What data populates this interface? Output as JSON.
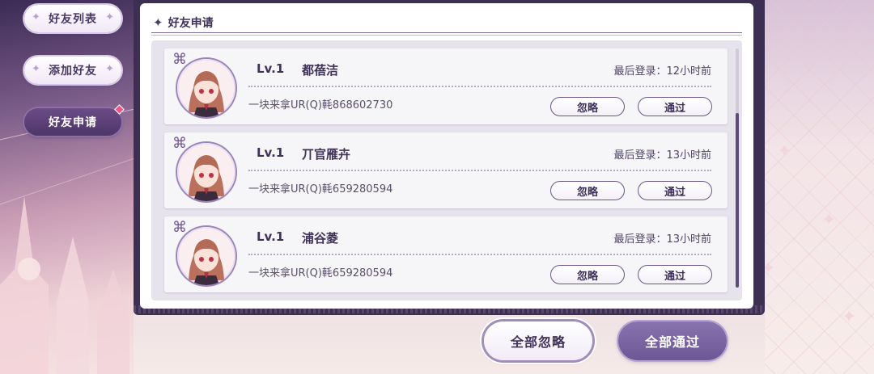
{
  "sidebar": {
    "items": [
      {
        "label": "好友列表",
        "active": false
      },
      {
        "label": "添加好友",
        "active": false
      },
      {
        "label": "好友申请",
        "active": true
      }
    ]
  },
  "panel": {
    "title": "好友申请",
    "title_icon": "four-point-star-icon"
  },
  "requests": [
    {
      "level": "Lv.1",
      "name": "都蓓洁",
      "last_login": "最后登录：12小时前",
      "message": "一块来拿UR(Q)軞868602730",
      "ignore_label": "忽略",
      "accept_label": "通过"
    },
    {
      "level": "Lv.1",
      "name": "丌官雁卉",
      "last_login": "最后登录：13小时前",
      "message": "一块来拿UR(Q)軞659280594",
      "ignore_label": "忽略",
      "accept_label": "通过"
    },
    {
      "level": "Lv.1",
      "name": "浦谷菱",
      "last_login": "最后登录：13小时前",
      "message": "一块来拿UR(Q)軞659280594",
      "ignore_label": "忽略",
      "accept_label": "通过"
    }
  ],
  "footer": {
    "ignore_all_label": "全部忽略",
    "accept_all_label": "全部通过"
  },
  "colors": {
    "accent_dark": "#4d3668",
    "accent_light": "#8a74b0",
    "notification_dot": "#e6588f",
    "text_primary": "#3f3158"
  }
}
